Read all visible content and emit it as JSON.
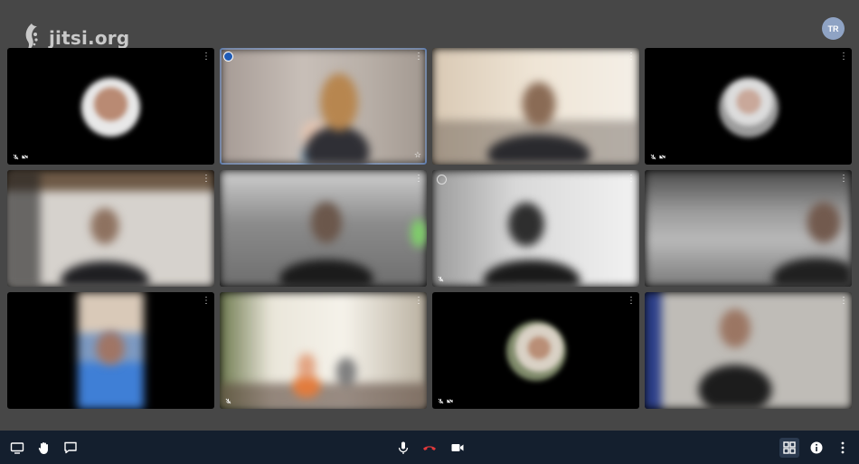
{
  "brand": {
    "name": "jitsi.org",
    "logo_icon": "jitsi-logo-icon"
  },
  "user": {
    "initials": "TR"
  },
  "tiles": [
    {
      "id": 1,
      "type": "avatar",
      "indicators": [
        "mic-muted-icon",
        "camera-off-icon"
      ]
    },
    {
      "id": 2,
      "type": "video",
      "active_speaker": true,
      "indicators": [
        "star-icon"
      ]
    },
    {
      "id": 3,
      "type": "video",
      "indicators": []
    },
    {
      "id": 4,
      "type": "avatar",
      "indicators": [
        "mic-muted-icon",
        "camera-off-icon"
      ]
    },
    {
      "id": 5,
      "type": "video",
      "indicators": []
    },
    {
      "id": 6,
      "type": "video",
      "indicators": []
    },
    {
      "id": 7,
      "type": "video",
      "indicators": [
        "mic-muted-icon"
      ]
    },
    {
      "id": 8,
      "type": "video",
      "indicators": []
    },
    {
      "id": 9,
      "type": "video",
      "indicators": []
    },
    {
      "id": 10,
      "type": "video",
      "indicators": [
        "mic-muted-icon"
      ]
    },
    {
      "id": 11,
      "type": "avatar",
      "indicators": [
        "mic-muted-icon",
        "camera-off-icon"
      ]
    },
    {
      "id": 12,
      "type": "video",
      "indicators": []
    }
  ],
  "toolbar": {
    "left": [
      "screen-share-icon",
      "raise-hand-icon",
      "chat-icon"
    ],
    "center": [
      "microphone-icon",
      "hangup-icon",
      "camera-icon"
    ],
    "right": [
      "tile-view-icon",
      "info-icon",
      "more-icon"
    ],
    "colors": {
      "hangup": "#e2393b",
      "background": "#141f2e"
    }
  }
}
